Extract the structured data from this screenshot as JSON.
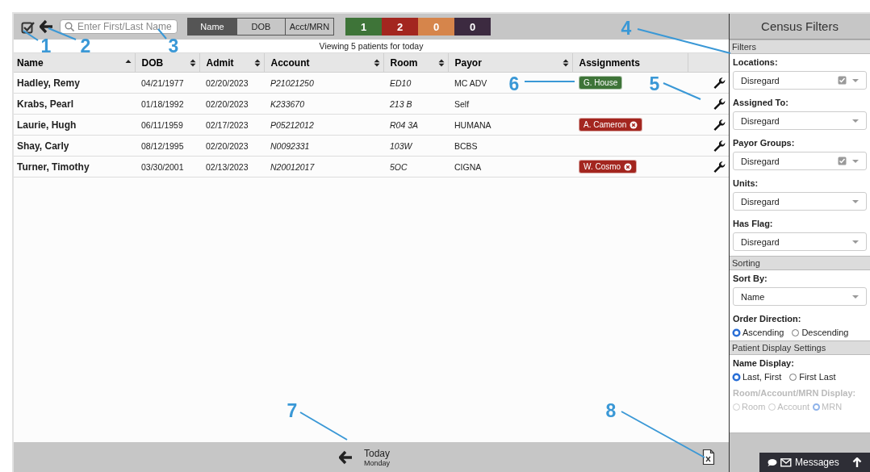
{
  "toolbar": {
    "search": {
      "placeholder": "Enter First/Last Name"
    },
    "search_modes": [
      {
        "label": "Name",
        "selected": true
      },
      {
        "label": "DOB",
        "selected": false
      },
      {
        "label": "Acct/MRN",
        "selected": false
      }
    ],
    "counts": [
      {
        "label": "1",
        "color": "#3e7438"
      },
      {
        "label": "2",
        "color": "#a3261f"
      },
      {
        "label": "0",
        "color": "#d6854b"
      },
      {
        "label": "0",
        "color": "#3c2a40"
      }
    ]
  },
  "status": "Viewing 5 patients for today",
  "table": {
    "columns": [
      {
        "label": "Name",
        "sortable": true,
        "sorted": true
      },
      {
        "label": "DOB",
        "sortable": true,
        "sorted": false
      },
      {
        "label": "Admit",
        "sortable": true,
        "sorted": false
      },
      {
        "label": "Account",
        "sortable": true,
        "sorted": false
      },
      {
        "label": "Room",
        "sortable": true,
        "sorted": false
      },
      {
        "label": "Payor",
        "sortable": true,
        "sorted": false
      },
      {
        "label": "Assignments",
        "sortable": false
      }
    ],
    "rows": [
      {
        "cells": [
          "Hadley, Remy",
          "04/21/1977",
          "02/20/2023",
          "P21021250",
          "ED10",
          "MC ADV"
        ],
        "assignment": {
          "label": "G. House",
          "color": "#3e7438",
          "removable": false
        }
      },
      {
        "cells": [
          "Krabs, Pearl",
          "01/18/1992",
          "02/20/2023",
          "K233670",
          "213 B",
          "Self"
        ]
      },
      {
        "cells": [
          "Laurie, Hugh",
          "06/11/1959",
          "02/17/2023",
          "P05212012",
          "R04 3A",
          "HUMANA"
        ],
        "assignment": {
          "label": "A. Cameron",
          "color": "#a3261f",
          "removable": true
        }
      },
      {
        "cells": [
          "Shay, Carly",
          "08/12/1995",
          "02/20/2023",
          "N0092331",
          "103W",
          "BCBS"
        ]
      },
      {
        "cells": [
          "Turner, Timothy",
          "03/30/2001",
          "02/13/2023",
          "N20012017",
          "5OC",
          "CIGNA"
        ],
        "assignment": {
          "label": "W. Cosmo",
          "color": "#a3261f",
          "removable": true
        }
      }
    ]
  },
  "footer": {
    "day": "Today",
    "weekday": "Monday"
  },
  "sidebar": {
    "title": "Census Filters",
    "sections": [
      {
        "title": "Filters",
        "fields": [
          {
            "kind": "select",
            "label": "Locations:",
            "value": "Disregard",
            "multi": true
          },
          {
            "kind": "select",
            "label": "Assigned To:",
            "value": "Disregard",
            "multi": false
          },
          {
            "kind": "select",
            "label": "Payor Groups:",
            "value": "Disregard",
            "multi": true
          },
          {
            "kind": "select",
            "label": "Units:",
            "value": "Disregard",
            "multi": false
          },
          {
            "kind": "select",
            "label": "Has Flag:",
            "value": "Disregard",
            "multi": false
          }
        ]
      },
      {
        "title": "Sorting",
        "fields": [
          {
            "kind": "select",
            "label": "Sort By:",
            "value": "Name",
            "multi": false
          },
          {
            "kind": "radio",
            "label": "Order Direction:",
            "disabled": false,
            "options": [
              {
                "label": "Ascending",
                "selected": true
              },
              {
                "label": "Descending",
                "selected": false
              }
            ]
          }
        ]
      },
      {
        "title": "Patient Display Settings",
        "fields": [
          {
            "kind": "radio",
            "label": "Name Display:",
            "disabled": false,
            "options": [
              {
                "label": "Last, First",
                "selected": true
              },
              {
                "label": "First Last",
                "selected": false
              }
            ]
          },
          {
            "kind": "radio",
            "label": "Room/Account/MRN Display:",
            "disabled": true,
            "options": [
              {
                "label": "Room",
                "selected": false
              },
              {
                "label": "Account",
                "selected": false
              },
              {
                "label": "MRN",
                "selected": true
              }
            ]
          }
        ]
      }
    ]
  },
  "messages": {
    "label": "Messages"
  },
  "callouts": [
    "1",
    "2",
    "3",
    "4",
    "5",
    "6",
    "7",
    "8"
  ]
}
